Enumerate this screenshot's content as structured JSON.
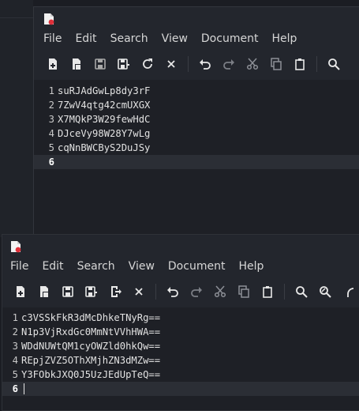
{
  "window1": {
    "menu": [
      "File",
      "Edit",
      "Search",
      "View",
      "Document",
      "Help"
    ],
    "lines": [
      {
        "num": "1",
        "text": "suRJAdGwLp8dy3rF"
      },
      {
        "num": "2",
        "text": "7ZwV4qtg42cmUXGX"
      },
      {
        "num": "3",
        "text": "X7MQkP3W29fewHdC"
      },
      {
        "num": "4",
        "text": "DJceVy98W28Y7wLg"
      },
      {
        "num": "5",
        "text": "cqNnBWCByS2DuJSy"
      },
      {
        "num": "6",
        "text": ""
      }
    ]
  },
  "window2": {
    "menu": [
      "File",
      "Edit",
      "Search",
      "View",
      "Document",
      "Help"
    ],
    "lines": [
      {
        "num": "1",
        "text": "c3VSSkFkR3dMcDhkeTNyRg=="
      },
      {
        "num": "2",
        "text": "N1p3VjRxdGc0MmNtVVhHWA=="
      },
      {
        "num": "3",
        "text": "WDdNUWtQM1cyOWZld0hkQw=="
      },
      {
        "num": "4",
        "text": "REpjZVZ5OThXMjhZN3dMZw=="
      },
      {
        "num": "5",
        "text": "Y3FObkJXQ0J5UzJEdUpTeQ=="
      },
      {
        "num": "6",
        "text": ""
      }
    ]
  },
  "colors": {
    "app_icon_red": "#e0303a",
    "editor_bg": "#1e2026",
    "window_bg": "#23262d"
  }
}
